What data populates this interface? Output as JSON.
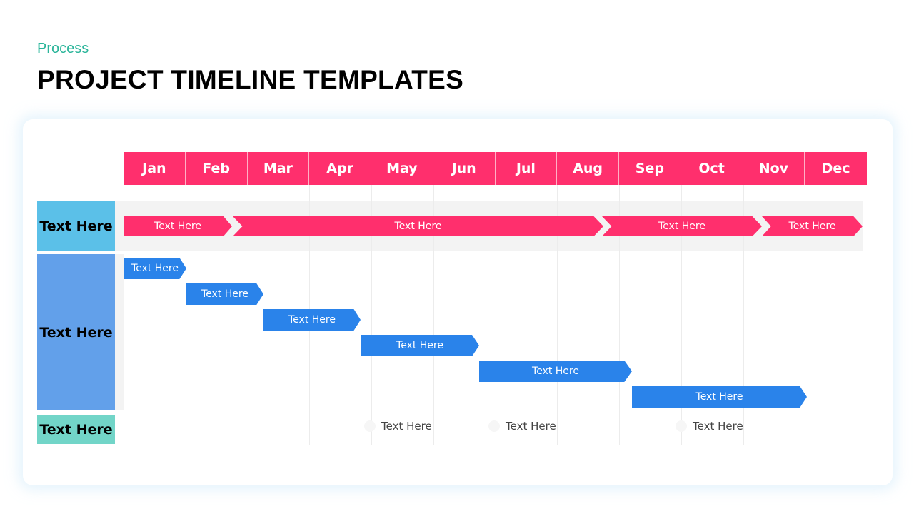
{
  "header": {
    "subtitle": "Process",
    "title": "PROJECT TIMELINE TEMPLATES"
  },
  "months": [
    "Jan",
    "Feb",
    "Mar",
    "Apr",
    "May",
    "Jun",
    "Jul",
    "Aug",
    "Sep",
    "Oct",
    "Nov",
    "Dec"
  ],
  "rows": [
    "Text Here",
    "Text Here",
    "Text Here"
  ],
  "phase_bars": [
    {
      "label": "Text Here",
      "start": "Jan",
      "end": "Feb"
    },
    {
      "label": "Text Here",
      "start": "Feb",
      "end": "Aug"
    },
    {
      "label": "Text Here",
      "start": "Sep",
      "end": "Nov"
    },
    {
      "label": "Text Here",
      "start": "Nov",
      "end": "Dec"
    }
  ],
  "task_bars": [
    "Text Here",
    "Text Here",
    "Text Here",
    "Text Here",
    "Text Here",
    "Text Here"
  ],
  "milestones": [
    "Text Here",
    "Text Here",
    "Text Here"
  ],
  "colors": {
    "accent": "#ff2f6d",
    "task": "#2a83ea",
    "row1": "#5bc0e8",
    "row2": "#62a0ea",
    "row3": "#72d5c8",
    "subtitle": "#2bb59a"
  }
}
